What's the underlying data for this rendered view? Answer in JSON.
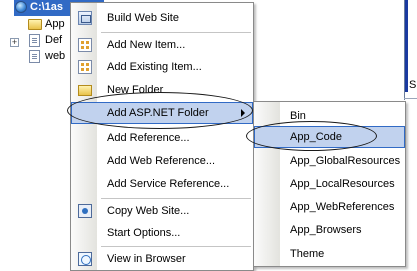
{
  "explorer": {
    "root_label": "C:\\1as",
    "rows": [
      {
        "label": "App"
      },
      {
        "label": "Def"
      },
      {
        "label": "web"
      }
    ],
    "right_strip_letter": "S"
  },
  "context_menu": {
    "items": [
      {
        "label": "Build Web Site",
        "icon": "build-icon"
      },
      {
        "label": "Add New Item...",
        "icon": "new-item-icon"
      },
      {
        "label": "Add Existing Item...",
        "icon": "existing-item-icon"
      },
      {
        "label": "New Folder",
        "icon": "folder-icon"
      },
      {
        "label": "Add ASP.NET Folder",
        "icon": "",
        "has_submenu": true,
        "highlighted": true
      },
      {
        "label": "Add Reference..."
      },
      {
        "label": "Add Web Reference..."
      },
      {
        "label": "Add Service Reference..."
      },
      {
        "label": "Copy Web Site...",
        "icon": "copy-web-site-icon"
      },
      {
        "label": "Start Options..."
      },
      {
        "label": "View in Browser",
        "icon": "browser-icon"
      }
    ]
  },
  "submenu": {
    "items": [
      {
        "label": "Bin"
      },
      {
        "label": "App_Code",
        "highlighted": true
      },
      {
        "label": "App_GlobalResources"
      },
      {
        "label": "App_LocalResources"
      },
      {
        "label": "App_WebReferences"
      },
      {
        "label": "App_Browsers"
      },
      {
        "label": "Theme"
      }
    ]
  },
  "colors": {
    "selection": "#316ac5",
    "menu_highlight": "#c1d2ee",
    "menu_highlight_border": "#316ac5"
  }
}
